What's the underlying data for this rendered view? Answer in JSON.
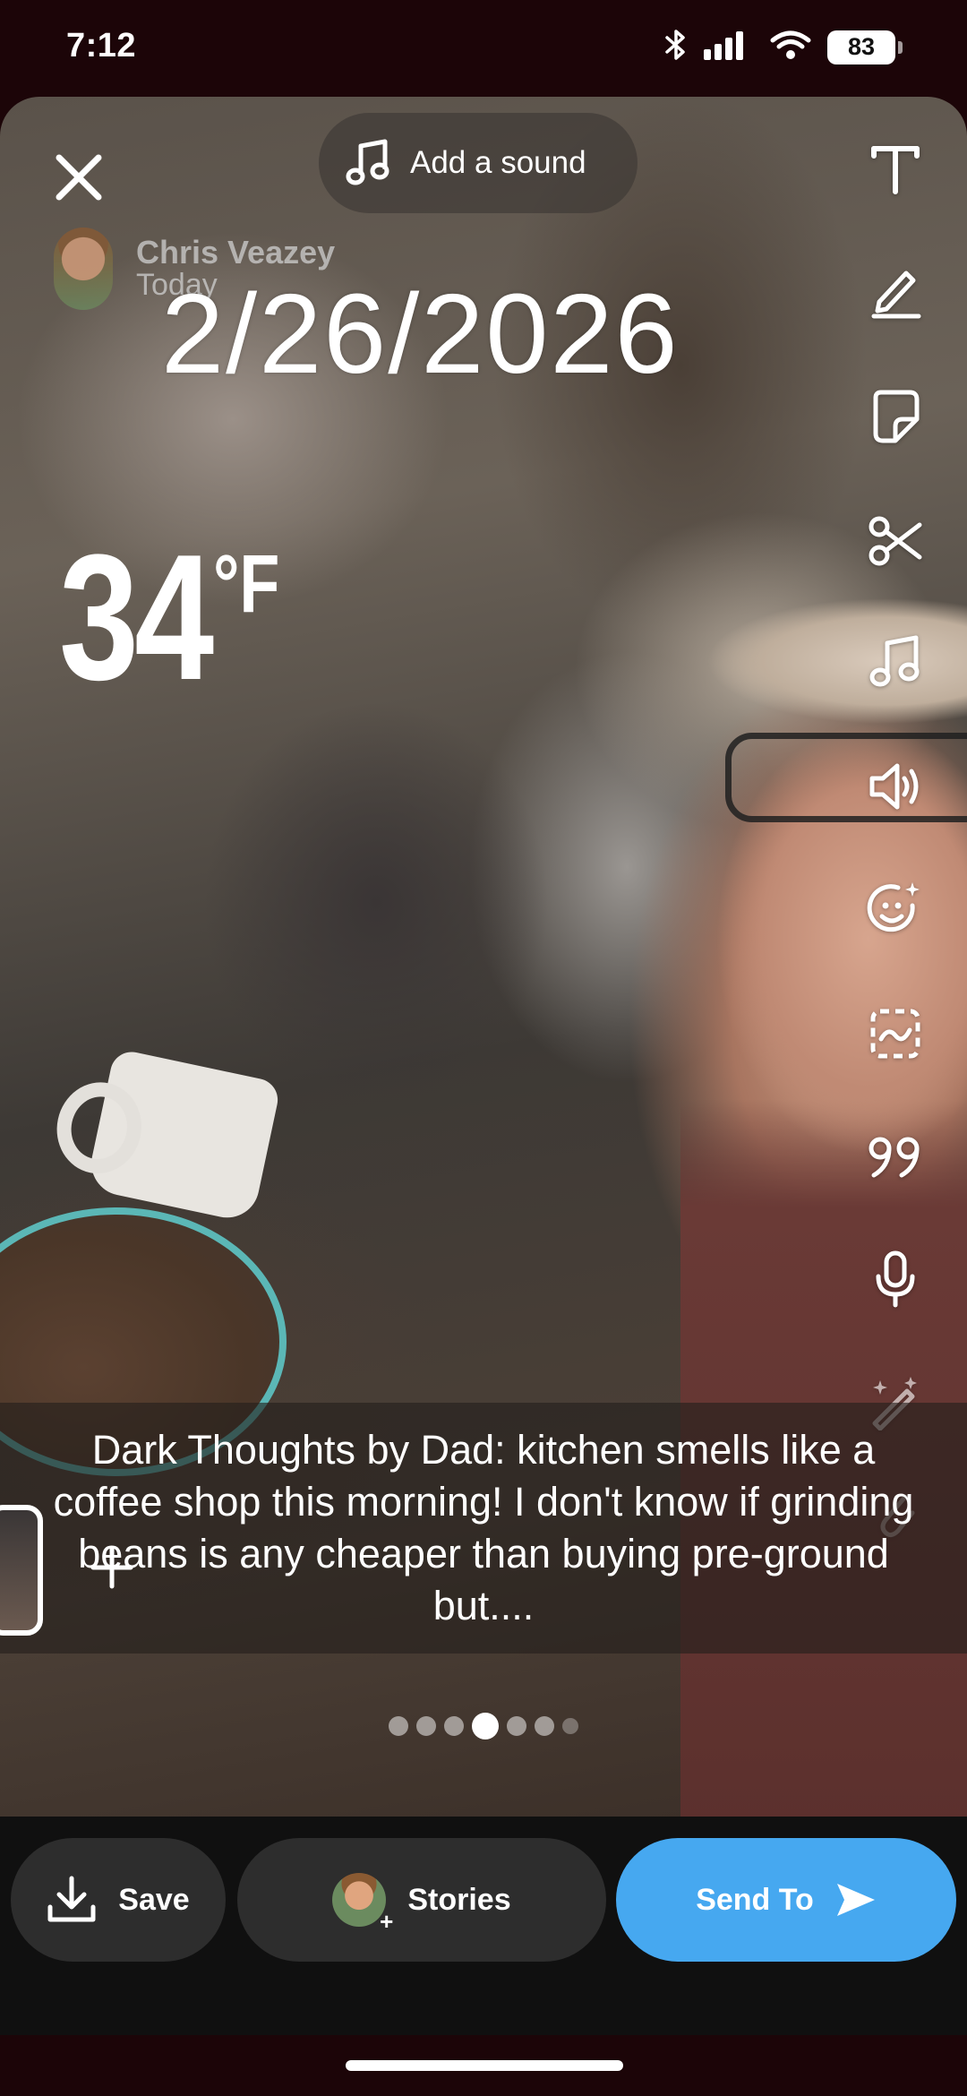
{
  "status_bar": {
    "time": "7:12",
    "battery": "83",
    "icons": [
      "bluetooth-icon",
      "cellular-signal-icon",
      "wifi-icon",
      "battery-icon"
    ]
  },
  "top": {
    "close_icon": "close-icon",
    "add_sound_label": "Add a sound"
  },
  "user": {
    "name": "Chris Veazey",
    "subtitle": "Today"
  },
  "stickers": {
    "date": "2/26/2026",
    "temperature": "34",
    "temperature_unit": "°F"
  },
  "right_rail": [
    {
      "name": "text-tool-icon"
    },
    {
      "name": "pencil-tool-icon"
    },
    {
      "name": "sticker-tool-icon"
    },
    {
      "name": "scissors-tool-icon"
    },
    {
      "name": "music-tool-icon"
    },
    {
      "name": "voice-changer-icon"
    },
    {
      "name": "lens-face-icon"
    },
    {
      "name": "crop-scan-icon"
    },
    {
      "name": "quote-tool-icon"
    },
    {
      "name": "microphone-icon"
    },
    {
      "name": "magic-wand-icon"
    },
    {
      "name": "paperclip-icon"
    }
  ],
  "caption": {
    "text": "Dark Thoughts by Dad: kitchen smells like a coffee shop this morning!  I don't know if grinding beans is any cheaper than buying pre-ground but...."
  },
  "pagination": {
    "count": 7,
    "active_index": 3
  },
  "actions": {
    "save_label": "Save",
    "stories_label": "Stories",
    "send_label": "Send To"
  },
  "colors": {
    "send_button": "#46a8f0",
    "action_bar": "#101010",
    "status_bar": "#1c0508"
  }
}
